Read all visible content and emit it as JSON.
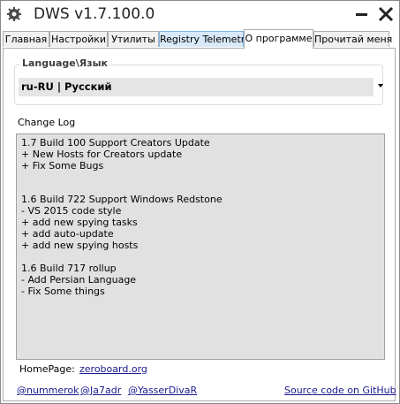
{
  "window": {
    "title": "DWS v1.7.100.0",
    "icon": "dws-app-icon",
    "minimize_icon": "minimize-icon",
    "close_icon": "close-icon"
  },
  "tabs": [
    {
      "label": "Главная",
      "state": "normal"
    },
    {
      "label": "Настройки",
      "state": "normal"
    },
    {
      "label": "Утилиты",
      "state": "normal"
    },
    {
      "label": "Registry Telemetry",
      "state": "hover"
    },
    {
      "label": "О программе",
      "state": "active"
    },
    {
      "label": "Прочитай меня",
      "state": "normal"
    }
  ],
  "language": {
    "legend": "Language\\Язык",
    "selected": "ru-RU | Русский"
  },
  "changelog": {
    "label": "Change Log",
    "lines": [
      "1.7 Build 100 Support Creators Update",
      "+ New Hosts for Creators update",
      "+ Fix Some Bugs",
      "",
      "",
      "1.6 Build 722 Support Windows Redstone",
      "- VS 2015 code style",
      "+ add new spying tasks",
      "+ add auto-update",
      "+ add new spying hosts",
      "",
      "1.6 Build 717 rollup",
      "- Add Persian Language",
      "- Fix Some things"
    ]
  },
  "homepage": {
    "label": "HomePage:",
    "link": "zeroboard.org"
  },
  "footer": {
    "authors": [
      "@nummerok",
      "@Ja7adr",
      "@YasserDivaR"
    ],
    "source_link": "Source code on GitHub"
  },
  "colors": {
    "accent_tab_hover": "#d8eaf9",
    "link": "#1a1a8f",
    "changelog_bg": "#e1e1e1"
  }
}
